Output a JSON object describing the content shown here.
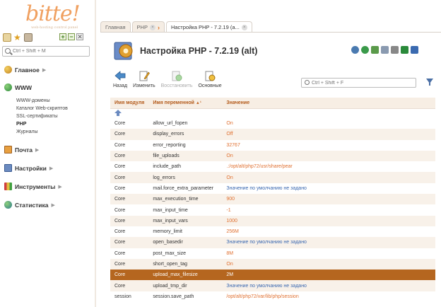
{
  "brand": {
    "logo": "bitte!",
    "tagline": "web-hosting control panel"
  },
  "sidebar": {
    "search_placeholder": "Ctrl + Shift + M",
    "sections": [
      {
        "label": "Главное"
      },
      {
        "label": "WWW"
      },
      {
        "label": "Почта"
      },
      {
        "label": "Настройки"
      },
      {
        "label": "Инструменты"
      },
      {
        "label": "Статистика"
      }
    ],
    "www_items": [
      {
        "label": "WWW-домены"
      },
      {
        "label": "Каталог Web-скриптов"
      },
      {
        "label": "SSL-сертификаты"
      },
      {
        "label": "PHP"
      },
      {
        "label": "Журналы"
      }
    ],
    "tool_add": "+",
    "tool_remove": "−"
  },
  "tabs": [
    {
      "label": "Главная"
    },
    {
      "label": "PHP"
    },
    {
      "label": "Настройка PHP - 7.2.19 (а..."
    }
  ],
  "page": {
    "title": "Настройка PHP - 7.2.19 (alt)"
  },
  "toolbar": {
    "back": "Назад",
    "edit": "Изменить",
    "restore": "Восстановить",
    "basic": "Основные",
    "search_placeholder": "Ctrl + Shift + F"
  },
  "table": {
    "headers": [
      "Имя модуля",
      "Имя переменной",
      "Значение"
    ],
    "sort_indicator": "▲¹",
    "rows": [
      {
        "module": "Core",
        "name": "allow_url_fopen",
        "value": "On"
      },
      {
        "module": "Core",
        "name": "display_errors",
        "value": "Off"
      },
      {
        "module": "Core",
        "name": "error_reporting",
        "value": "32767"
      },
      {
        "module": "Core",
        "name": "file_uploads",
        "value": "On"
      },
      {
        "module": "Core",
        "name": "include_path",
        "value": ".:/opt/alt/php72/usr/share/pear"
      },
      {
        "module": "Core",
        "name": "log_errors",
        "value": "On"
      },
      {
        "module": "Core",
        "name": "mail.force_extra_parameter",
        "value": "Значение по умолчанию не задано",
        "default": true
      },
      {
        "module": "Core",
        "name": "max_execution_time",
        "value": "900"
      },
      {
        "module": "Core",
        "name": "max_input_time",
        "value": "-1"
      },
      {
        "module": "Core",
        "name": "max_input_vars",
        "value": "1000"
      },
      {
        "module": "Core",
        "name": "memory_limit",
        "value": "256M"
      },
      {
        "module": "Core",
        "name": "open_basedir",
        "value": "Значение по умолчанию не задано",
        "default": true
      },
      {
        "module": "Core",
        "name": "post_max_size",
        "value": "8M"
      },
      {
        "module": "Core",
        "name": "short_open_tag",
        "value": "On"
      },
      {
        "module": "Core",
        "name": "upload_max_filesize",
        "value": "2M",
        "selected": true
      },
      {
        "module": "Core",
        "name": "upload_tmp_dir",
        "value": "Значение по умолчанию не задано",
        "default": true
      },
      {
        "module": "session",
        "name": "session.save_path",
        "value": "/opt/alt/php72/var/lib/php/session"
      }
    ]
  },
  "colors": {
    "accent": "#e07030",
    "selected_row": "#b5661f",
    "default_value": "#3a68b0",
    "header_text": "#b35a1a"
  }
}
